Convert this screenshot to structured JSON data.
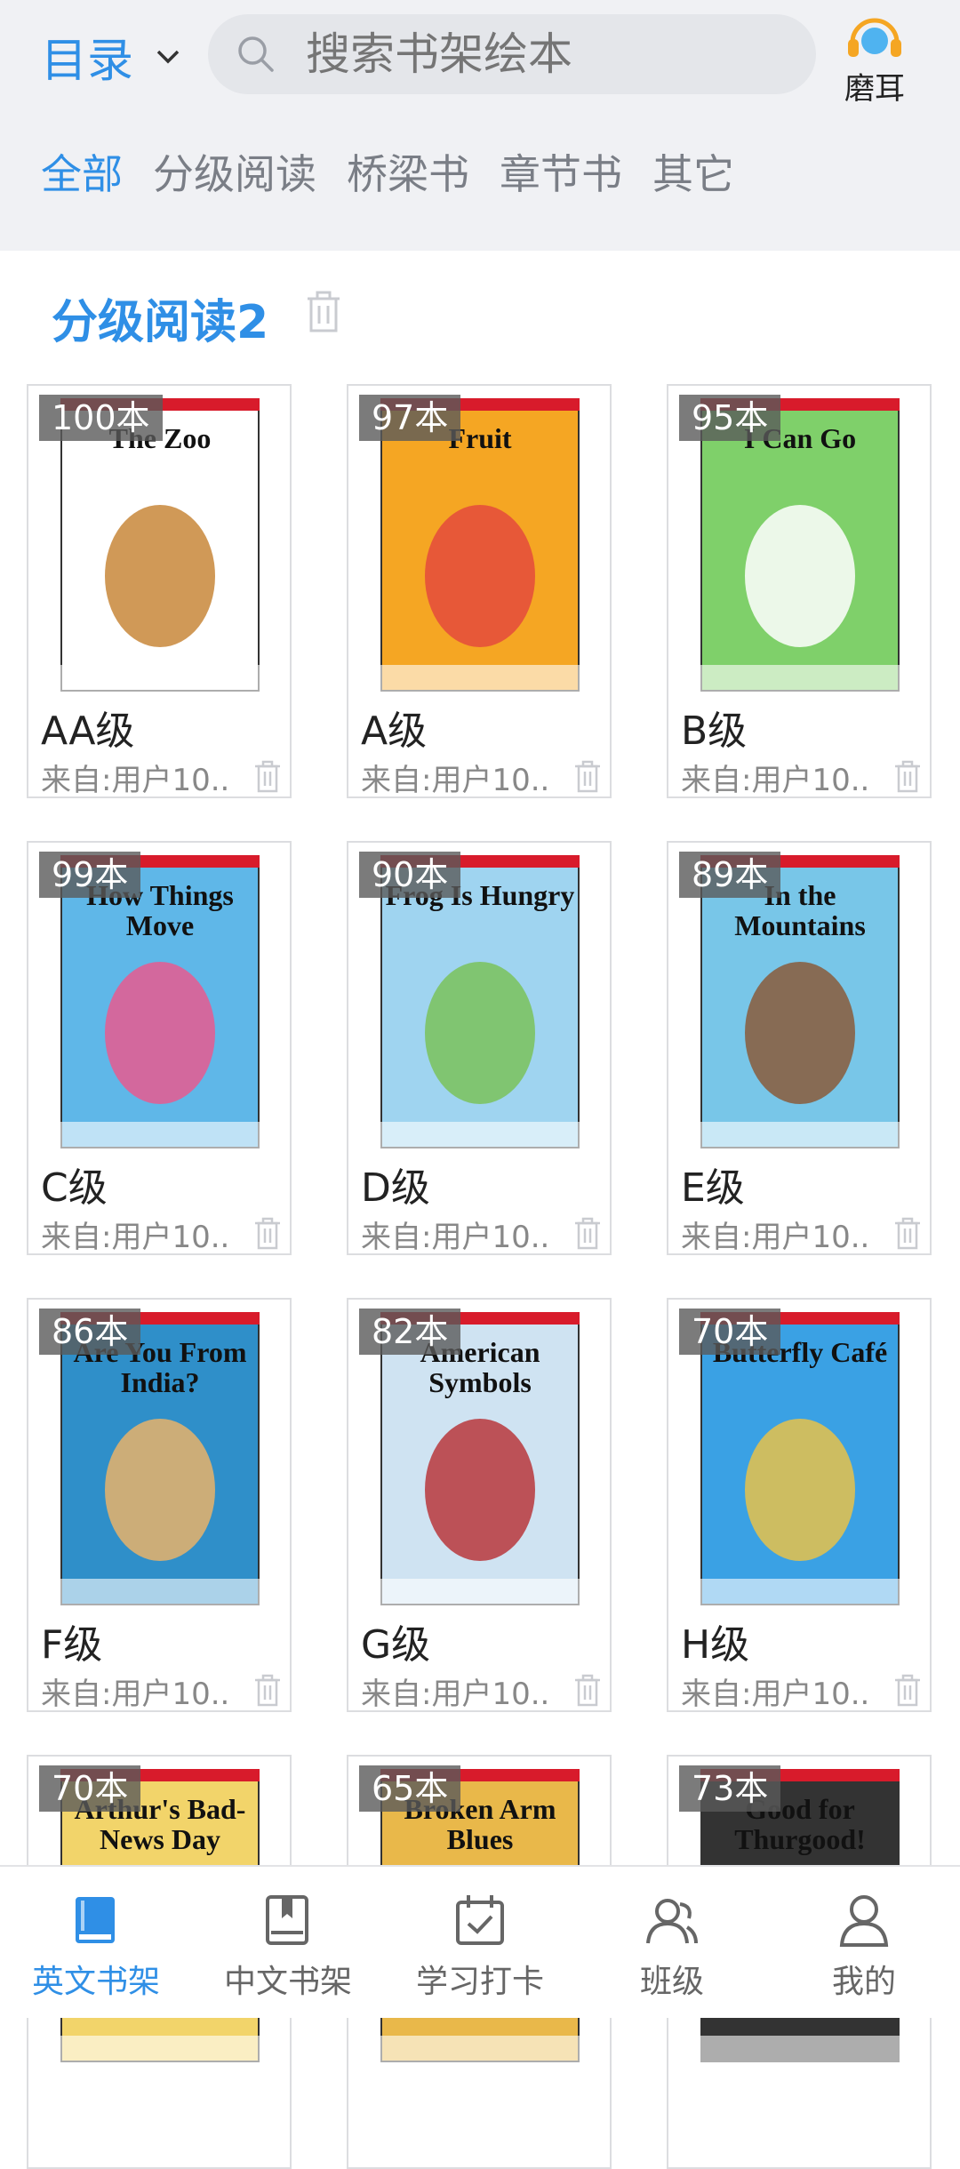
{
  "header": {
    "catalog_label": "目录",
    "search_placeholder": "搜索书架绘本",
    "moer_label": "磨耳"
  },
  "filters": [
    {
      "label": "全部",
      "active": true
    },
    {
      "label": "分级阅读",
      "active": false
    },
    {
      "label": "桥梁书",
      "active": false
    },
    {
      "label": "章节书",
      "active": false
    },
    {
      "label": "其它",
      "active": false
    }
  ],
  "section": {
    "title": "分级阅读2"
  },
  "books": [
    {
      "count": "100本",
      "level": "AA级",
      "source": "来自:用户10..",
      "cover_title": "The Zoo",
      "cover_bg": "#ffffff",
      "cover_color": "#c8873a"
    },
    {
      "count": "97本",
      "level": "A级",
      "source": "来自:用户10..",
      "cover_title": "Fruit",
      "cover_bg": "#f5a623",
      "cover_color": "#e44a3c"
    },
    {
      "count": "95本",
      "level": "B级",
      "source": "来自:用户10..",
      "cover_title": "I Can Go",
      "cover_bg": "#7fd06a",
      "cover_color": "#ffffff"
    },
    {
      "count": "99本",
      "level": "C级",
      "source": "来自:用户10..",
      "cover_title": "How Things Move",
      "cover_bg": "#5fb7e8",
      "cover_color": "#e85b8f"
    },
    {
      "count": "90本",
      "level": "D级",
      "source": "来自:用户10..",
      "cover_title": "Frog Is Hungry",
      "cover_bg": "#9fd4f0",
      "cover_color": "#7ac25a"
    },
    {
      "count": "89本",
      "level": "E级",
      "source": "来自:用户10..",
      "cover_title": "In the Mountains",
      "cover_bg": "#78c6e8",
      "cover_color": "#8a5a3a"
    },
    {
      "count": "86本",
      "level": "F级",
      "source": "来自:用户10..",
      "cover_title": "Are You From India?",
      "cover_bg": "#2f8fc9",
      "cover_color": "#e8b36a"
    },
    {
      "count": "82本",
      "level": "G级",
      "source": "来自:用户10..",
      "cover_title": "American Symbols",
      "cover_bg": "#cfe3f2",
      "cover_color": "#b8373c"
    },
    {
      "count": "70本",
      "level": "H级",
      "source": "来自:用户10..",
      "cover_title": "Butterfly Café",
      "cover_bg": "#3aa1e4",
      "cover_color": "#e8c24a"
    },
    {
      "count": "70本",
      "level": "",
      "source": "",
      "cover_title": "Arthur's Bad-News Day",
      "cover_bg": "#f2d46a",
      "cover_color": "#d8922a"
    },
    {
      "count": "65本",
      "level": "",
      "source": "",
      "cover_title": "Broken Arm Blues",
      "cover_bg": "#e9b84a",
      "cover_color": "#b8742a"
    },
    {
      "count": "73本",
      "level": "",
      "source": "",
      "cover_title": "Good for Thurgood!",
      "cover_bg": "#333333",
      "cover_color": "#888888"
    }
  ],
  "tabbar": [
    {
      "label": "英文书架",
      "icon": "book-icon",
      "active": true
    },
    {
      "label": "中文书架",
      "icon": "book-outline-icon",
      "active": false
    },
    {
      "label": "学习打卡",
      "icon": "calendar-check-icon",
      "active": false
    },
    {
      "label": "班级",
      "icon": "group-icon",
      "active": false
    },
    {
      "label": "我的",
      "icon": "user-icon",
      "active": false
    }
  ]
}
